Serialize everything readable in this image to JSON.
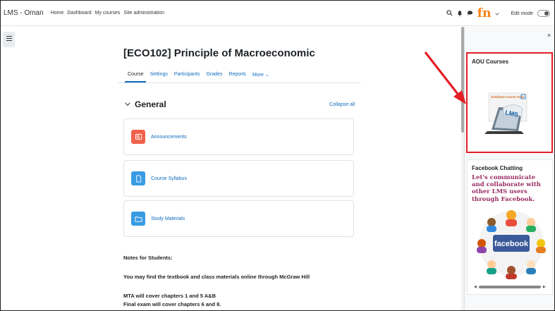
{
  "navbar": {
    "brand": "LMS - Oman",
    "links": [
      "Home",
      "Dashboard",
      "My courses",
      "Site administration"
    ],
    "edit_mode_label": "Edit mode",
    "logo_text": "fn"
  },
  "course": {
    "title": "[ECO102] Principle of Macroeconomic",
    "tabs": [
      "Course",
      "Settings",
      "Participants",
      "Grades",
      "Reports",
      "More ⌄"
    ]
  },
  "section": {
    "title": "General",
    "collapse_label": "Collapse all",
    "activities": [
      {
        "label": "Announcements",
        "color": "#f0624d"
      },
      {
        "label": "Course Syllabus",
        "color": "#399be2"
      },
      {
        "label": "Study Materials",
        "color": "#399be2"
      }
    ]
  },
  "notes": {
    "heading": "Notes for Students:",
    "line1": "You may find the textbook and class materials online through McGraw Hill",
    "line2": "MTA will cover chapters 1 and 5 A&B",
    "line3": "Final exam will cover chapters 6 and 8."
  },
  "drawer": {
    "close_label": "×",
    "aou_block_title": "AOU Courses",
    "aou_image_text": "Distribute Course Tools",
    "aou_image_lms": "LMS",
    "fb_block_title": "Facebook Chatting",
    "fb_text": "Let's communicate and collaborate with other LMS users through Facebook.",
    "fb_image_label": "facebook"
  },
  "colors": {
    "link": "#0f6cbf",
    "highlight": "#e41e25",
    "fb_text": "#9b2c63",
    "facebook": "#3b5998"
  }
}
